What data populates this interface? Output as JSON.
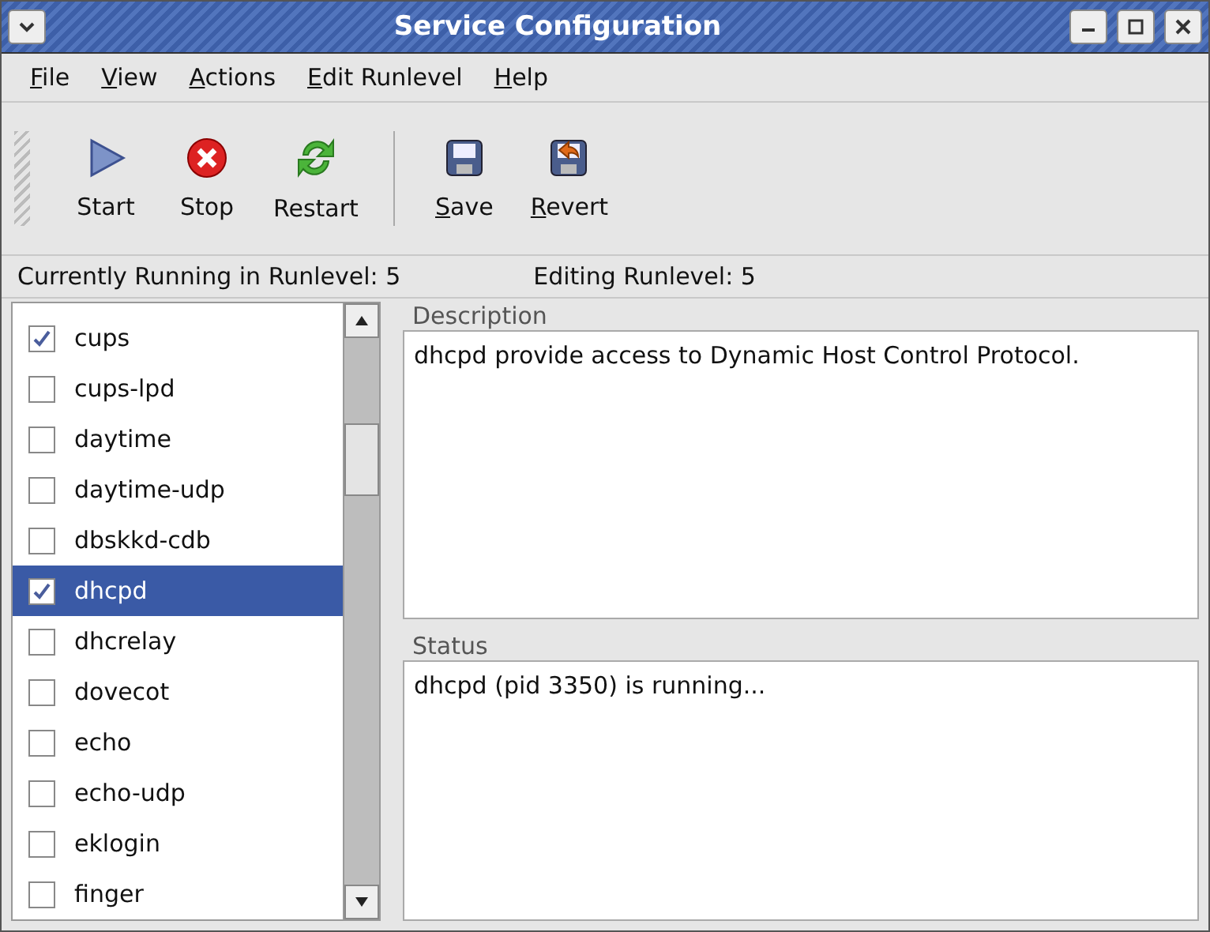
{
  "window": {
    "title": "Service Configuration"
  },
  "menu": [
    {
      "label": "File",
      "underlined_first": true
    },
    {
      "label": "View",
      "underlined_first": true
    },
    {
      "label": "Actions",
      "underlined_first": true
    },
    {
      "label": "Edit Runlevel",
      "underlined_first": true
    },
    {
      "label": "Help",
      "underlined_first": true
    }
  ],
  "toolbar": [
    {
      "kind": "start",
      "label": "Start",
      "underlined_first": false
    },
    {
      "kind": "stop",
      "label": "Stop",
      "underlined_first": false
    },
    {
      "kind": "restart",
      "label": "Restart",
      "underlined_first": false
    },
    {
      "kind": "separator"
    },
    {
      "kind": "save",
      "label": "Save",
      "underlined_first": true
    },
    {
      "kind": "revert",
      "label": "Revert",
      "underlined_first": true
    }
  ],
  "runlevel_bar": {
    "running": "Currently Running in Runlevel: 5",
    "editing": "Editing Runlevel: 5"
  },
  "services": [
    {
      "name": "cups",
      "checked": true,
      "selected": false
    },
    {
      "name": "cups-lpd",
      "checked": false,
      "selected": false
    },
    {
      "name": "daytime",
      "checked": false,
      "selected": false
    },
    {
      "name": "daytime-udp",
      "checked": false,
      "selected": false
    },
    {
      "name": "dbskkd-cdb",
      "checked": false,
      "selected": false
    },
    {
      "name": "dhcpd",
      "checked": true,
      "selected": true
    },
    {
      "name": "dhcrelay",
      "checked": false,
      "selected": false
    },
    {
      "name": "dovecot",
      "checked": false,
      "selected": false
    },
    {
      "name": "echo",
      "checked": false,
      "selected": false
    },
    {
      "name": "echo-udp",
      "checked": false,
      "selected": false
    },
    {
      "name": "eklogin",
      "checked": false,
      "selected": false
    },
    {
      "name": "finger",
      "checked": false,
      "selected": false
    }
  ],
  "description": {
    "heading": "Description",
    "text": "dhcpd provide access to Dynamic Host Control Protocol."
  },
  "status": {
    "heading": "Status",
    "text": "dhcpd (pid 3350) is running..."
  }
}
